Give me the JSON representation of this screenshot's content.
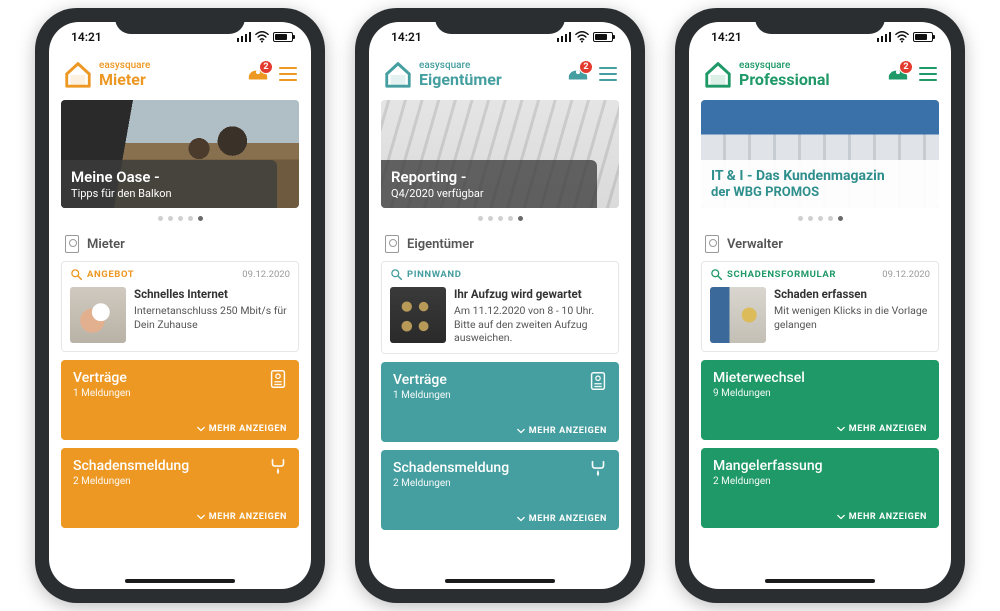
{
  "status_time": "14:21",
  "notif_count": "2",
  "accents": {
    "mieter": "#ec9823",
    "eigen": "#459e9f",
    "prof": "#1e9967"
  },
  "phones": [
    {
      "key": "mieter",
      "brand_sub": "easysquare",
      "brand_main": "Mieter",
      "hero_title": "Meine Oase -",
      "hero_sub": "Tipps für den Balkon",
      "hero_style": "dark",
      "hero_bg": "bg-mieter",
      "section": "Mieter",
      "feat": {
        "tag": "ANGEBOT",
        "date": "09.12.2020",
        "heading": "Schnelles Internet",
        "text": "Internetanschluss 250 Mbit/s für Dein Zuhause",
        "thumb": "thumb-hand"
      },
      "tiles": [
        {
          "title": "Verträge",
          "sub": "1 Meldungen",
          "icon": "doc",
          "more": "MEHR ANZEIGEN"
        },
        {
          "title": "Schadensmeldung",
          "sub": "2 Meldungen",
          "icon": "leak",
          "more": "MEHR ANZEIGEN"
        }
      ]
    },
    {
      "key": "eigen",
      "brand_sub": "easysquare",
      "brand_main": "Eigentümer",
      "hero_title": "Reporting -",
      "hero_sub": "Q4/2020 verfügbar",
      "hero_style": "dark",
      "hero_bg": "bg-eigen",
      "section": "Eigentümer",
      "feat": {
        "tag": "PINNWAND",
        "date": "",
        "heading": "Ihr Aufzug wird gewartet",
        "text": "Am 11.12.2020 von 8 - 10 Uhr. Bitte auf den zweiten Aufzug ausweichen.",
        "thumb": "thumb-elev"
      },
      "tiles": [
        {
          "title": "Verträge",
          "sub": "1 Meldungen",
          "icon": "doc",
          "more": "MEHR ANZEIGEN"
        },
        {
          "title": "Schadensmeldung",
          "sub": "2 Meldungen",
          "icon": "leak",
          "more": "MEHR ANZEIGEN"
        }
      ]
    },
    {
      "key": "prof",
      "brand_sub": "easysquare",
      "brand_main": "Professional",
      "hero_title": "IT & I - Das Kundenmagazin",
      "hero_sub": "der WBG PROMOS",
      "hero_style": "white",
      "hero_bg": "bg-prof",
      "section": "Verwalter",
      "feat": {
        "tag": "SCHADENSFORMULAR",
        "date": "09.12.2020",
        "heading": "Schaden erfassen",
        "text": "Mit wenigen Klicks in die Vorlage gelangen",
        "thumb": "thumb-tools"
      },
      "tiles": [
        {
          "title": "Mieterwechsel",
          "sub": "9 Meldungen",
          "icon": "",
          "more": "MEHR ANZEIGEN"
        },
        {
          "title": "Mangelerfassung",
          "sub": "2 Meldungen",
          "icon": "",
          "more": "MEHR ANZEIGEN"
        }
      ]
    }
  ]
}
